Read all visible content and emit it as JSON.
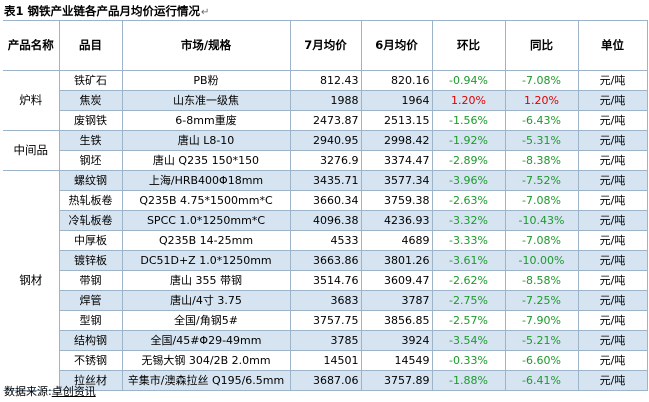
{
  "title": "表1 钢铁产业链各产品月均价运行情况",
  "headers": [
    "产品名称",
    "品目",
    "市场/规格",
    "7月均价",
    "6月均价",
    "环比",
    "同比",
    "单位"
  ],
  "groups": [
    {
      "category": "炉料",
      "rows": [
        {
          "item": "铁矿石",
          "spec": "PB粉",
          "jul": "812.43",
          "jun": "820.16",
          "mom": "-0.94%",
          "yoy": "-7.08%",
          "unit": "元/吨"
        },
        {
          "item": "焦炭",
          "spec": "山东准一级焦",
          "jul": "1988",
          "jun": "1964",
          "mom": "1.20%",
          "yoy": "1.20%",
          "unit": "元/吨"
        },
        {
          "item": "废钢铁",
          "spec": "6-8mm重废",
          "jul": "2473.87",
          "jun": "2513.15",
          "mom": "-1.56%",
          "yoy": "-6.43%",
          "unit": "元/吨"
        }
      ]
    },
    {
      "category": "中间品",
      "rows": [
        {
          "item": "生铁",
          "spec": "唐山 L8-10",
          "jul": "2940.95",
          "jun": "2998.42",
          "mom": "-1.92%",
          "yoy": "-5.31%",
          "unit": "元/吨"
        },
        {
          "item": "钢坯",
          "spec": "唐山 Q235 150*150",
          "jul": "3276.9",
          "jun": "3374.47",
          "mom": "-2.89%",
          "yoy": "-8.38%",
          "unit": "元/吨"
        }
      ]
    },
    {
      "category": "钢材",
      "rows": [
        {
          "item": "螺纹钢",
          "spec": "上海/HRB400Φ18mm",
          "jul": "3435.71",
          "jun": "3577.34",
          "mom": "-3.96%",
          "yoy": "-7.52%",
          "unit": "元/吨"
        },
        {
          "item": "热轧板卷",
          "spec": "Q235B 4.75*1500mm*C",
          "jul": "3660.34",
          "jun": "3759.38",
          "mom": "-2.63%",
          "yoy": "-7.08%",
          "unit": "元/吨"
        },
        {
          "item": "冷轧板卷",
          "spec": "SPCC 1.0*1250mm*C",
          "jul": "4096.38",
          "jun": "4236.93",
          "mom": "-3.32%",
          "yoy": "-10.43%",
          "unit": "元/吨"
        },
        {
          "item": "中厚板",
          "spec": "Q235B 14-25mm",
          "jul": "4533",
          "jun": "4689",
          "mom": "-3.33%",
          "yoy": "-7.08%",
          "unit": "元/吨"
        },
        {
          "item": "镀锌板",
          "spec": "DC51D+Z 1.0*1250mm",
          "jul": "3663.86",
          "jun": "3801.26",
          "mom": "-3.61%",
          "yoy": "-10.00%",
          "unit": "元/吨"
        },
        {
          "item": "带钢",
          "spec": "唐山 355 带钢",
          "jul": "3514.76",
          "jun": "3609.47",
          "mom": "-2.62%",
          "yoy": "-8.58%",
          "unit": "元/吨"
        },
        {
          "item": "焊管",
          "spec": "唐山/4寸 3.75",
          "jul": "3683",
          "jun": "3787",
          "mom": "-2.75%",
          "yoy": "-7.25%",
          "unit": "元/吨"
        },
        {
          "item": "型钢",
          "spec": "全国/角钢5#",
          "jul": "3757.75",
          "jun": "3856.85",
          "mom": "-2.57%",
          "yoy": "-7.90%",
          "unit": "元/吨"
        },
        {
          "item": "结构钢",
          "spec": "全国/45#Φ29-49mm",
          "jul": "3785",
          "jun": "3924",
          "mom": "-3.54%",
          "yoy": "-5.21%",
          "unit": "元/吨"
        },
        {
          "item": "不锈钢",
          "spec": "无锡大钢 304/2B 2.0mm",
          "jul": "14501",
          "jun": "14549",
          "mom": "-0.33%",
          "yoy": "-6.60%",
          "unit": "元/吨"
        },
        {
          "item": "拉丝材",
          "spec": "辛集市/澳森拉丝 Q195/6.5mm",
          "jul": "3687.06",
          "jun": "3757.89",
          "mom": "-1.88%",
          "yoy": "-6.41%",
          "unit": "元/吨"
        }
      ]
    }
  ],
  "footer": {
    "label": "数据来源:",
    "source": "卓创资讯"
  },
  "colors": {
    "negative": "#1c9a2c",
    "positive": "#e00000",
    "shade": "#d6e4f1"
  }
}
